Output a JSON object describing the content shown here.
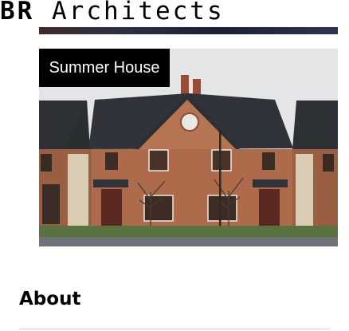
{
  "header": {
    "brand_initials": "BR",
    "brand_name": "Architects"
  },
  "hero": {
    "caption": "Summer House",
    "image_subject": "house-photo"
  },
  "about": {
    "title": "About"
  },
  "colors": {
    "brick": "#a8694a",
    "roof": "#2b2e33",
    "sky": "#e3e4e6",
    "lawn": "#4f6b3a",
    "tag_background": "#000000"
  }
}
